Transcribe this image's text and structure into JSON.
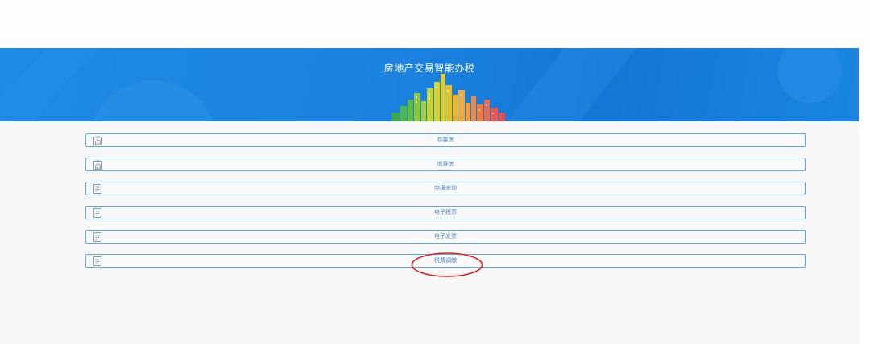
{
  "banner": {
    "title": "房地产交易智能办税"
  },
  "menu": {
    "items": [
      {
        "label": "存量房",
        "icon": "clipboard-house-icon"
      },
      {
        "label": "增量房",
        "icon": "clipboard-house-icon"
      },
      {
        "label": "申报查询",
        "icon": "document-icon"
      },
      {
        "label": "电子税票",
        "icon": "document-icon"
      },
      {
        "label": "电子发票",
        "icon": "document-icon"
      },
      {
        "label": "税费调缴",
        "icon": "document-icon"
      }
    ]
  },
  "annotation": {
    "color": "#e02020",
    "highlighted_item": "税费调缴"
  },
  "colors": {
    "banner_blue": "#1b83df",
    "item_border": "#57a8e6",
    "item_text": "#4a89c8"
  }
}
